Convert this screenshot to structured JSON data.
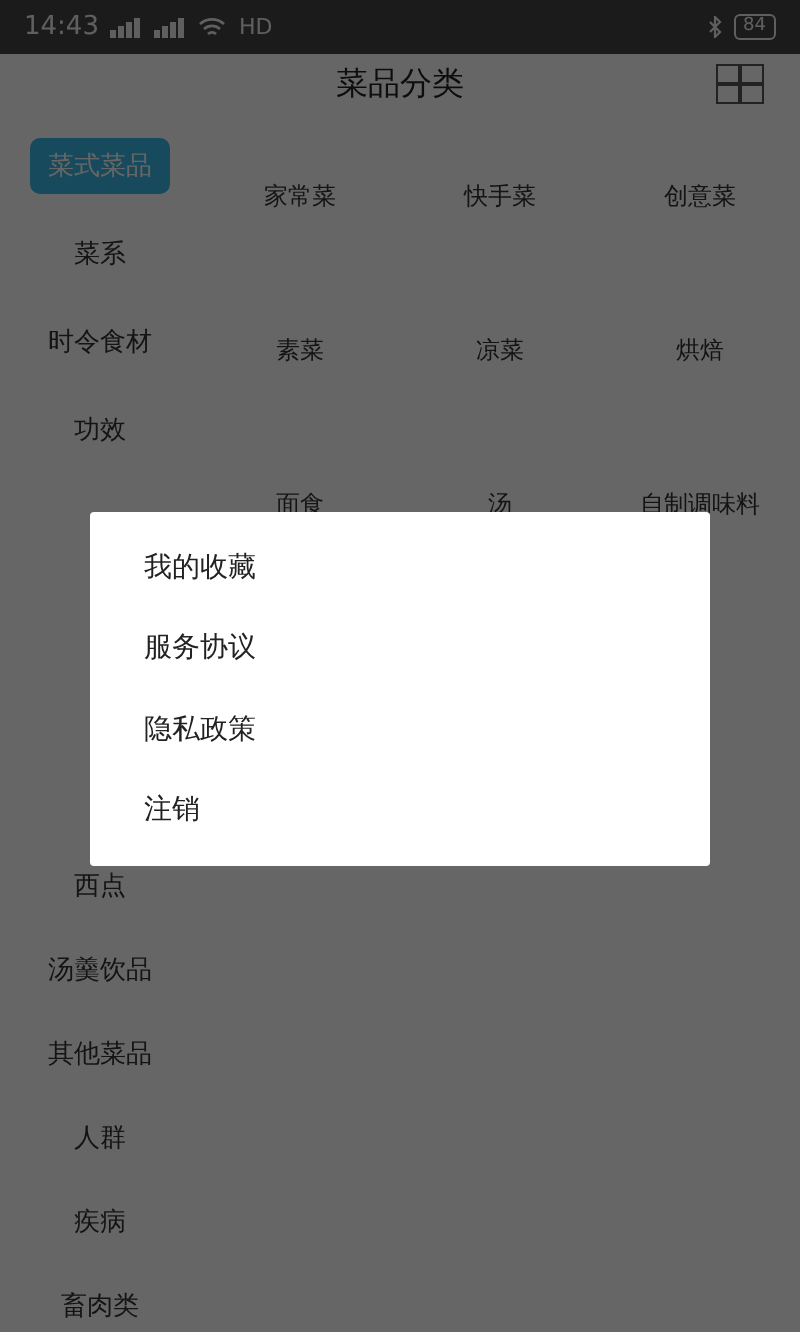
{
  "status_bar": {
    "time": "14:43",
    "network": "HD",
    "battery": "84"
  },
  "header": {
    "title": "菜品分类"
  },
  "sidebar": {
    "items": [
      {
        "label": "菜式菜品",
        "selected": true
      },
      {
        "label": "菜系",
        "selected": false
      },
      {
        "label": "时令食材",
        "selected": false
      },
      {
        "label": "功效",
        "selected": false
      }
    ],
    "items_below": [
      {
        "label": "西点",
        "selected": false
      },
      {
        "label": "汤羹饮品",
        "selected": false
      },
      {
        "label": "其他菜品",
        "selected": false
      },
      {
        "label": "人群",
        "selected": false
      },
      {
        "label": "疾病",
        "selected": false
      },
      {
        "label": "畜肉类",
        "selected": false
      }
    ]
  },
  "grid": {
    "items": [
      "家常菜",
      "快手菜",
      "创意菜",
      "素菜",
      "凉菜",
      "烘焙",
      "面食",
      "汤",
      "自制调味料"
    ]
  },
  "menu": {
    "items": [
      "我的收藏",
      "服务协议",
      "隐私政策",
      "注销"
    ]
  }
}
